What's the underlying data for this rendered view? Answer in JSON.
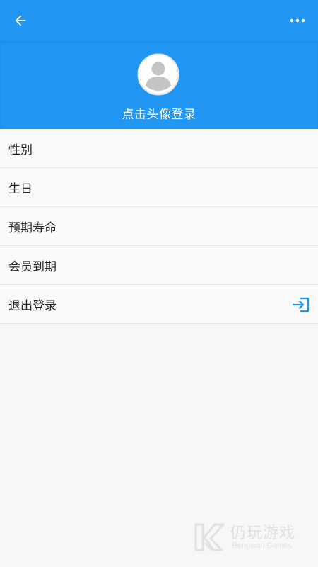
{
  "appbar": {
    "back_icon": "arrow-left-icon",
    "more_icon": "more-horizontal-icon",
    "background": "#2196F3"
  },
  "profile": {
    "avatar_icon": "user-avatar-icon",
    "login_text": "点击头像登录"
  },
  "menu": {
    "items": [
      {
        "label": "性别"
      },
      {
        "label": "生日"
      },
      {
        "label": "预期寿命"
      },
      {
        "label": "会员到期"
      },
      {
        "label": "退出登录",
        "icon": "logout-icon"
      }
    ]
  },
  "watermark": {
    "brand_cn": "仍玩游戏",
    "brand_en": "Rengwan Games"
  }
}
